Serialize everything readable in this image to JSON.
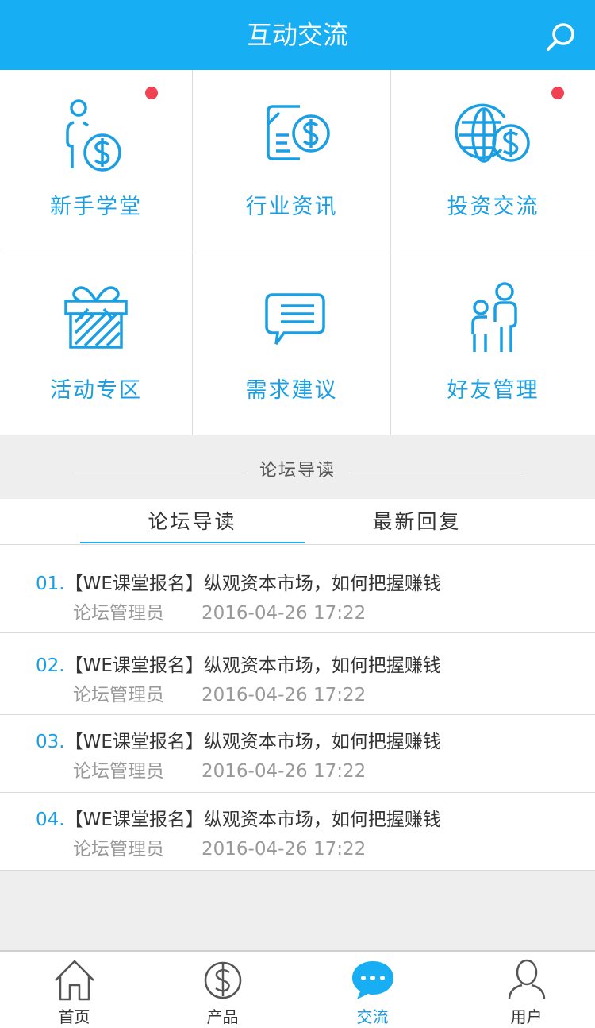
{
  "header": {
    "title": "互动交流",
    "search_icon": "search-icon"
  },
  "grid": [
    {
      "label": "新手学堂",
      "icon": "person-dollar-icon",
      "badge": true
    },
    {
      "label": "行业资讯",
      "icon": "document-dollar-icon",
      "badge": false
    },
    {
      "label": "投资交流",
      "icon": "globe-dollar-icon",
      "badge": true
    },
    {
      "label": "活动专区",
      "icon": "gift-icon",
      "badge": false
    },
    {
      "label": "需求建议",
      "icon": "message-bubble-icon",
      "badge": false
    },
    {
      "label": "好友管理",
      "icon": "friends-icon",
      "badge": false
    }
  ],
  "section": {
    "title": "论坛导读"
  },
  "tabs": [
    {
      "label": "论坛导读",
      "active": true
    },
    {
      "label": "最新回复",
      "active": false
    }
  ],
  "posts": [
    {
      "num": "01.",
      "title": "【WE课堂报名】纵观资本市场，如何把握赚钱",
      "author": "论坛管理员",
      "time": "2016-04-26  17:22"
    },
    {
      "num": "02.",
      "title": "【WE课堂报名】纵观资本市场，如何把握赚钱",
      "author": "论坛管理员",
      "time": "2016-04-26  17:22"
    },
    {
      "num": "03.",
      "title": "【WE课堂报名】纵观资本市场，如何把握赚钱",
      "author": "论坛管理员",
      "time": "2016-04-26  17:22"
    },
    {
      "num": "04.",
      "title": "【WE课堂报名】纵观资本市场，如何把握赚钱",
      "author": "论坛管理员",
      "time": "2016-04-26  17:22"
    }
  ],
  "tabbar": [
    {
      "label": "首页",
      "icon": "home-icon",
      "active": false
    },
    {
      "label": "产品",
      "icon": "dollar-icon",
      "active": false
    },
    {
      "label": "交流",
      "icon": "chat-icon",
      "active": true
    },
    {
      "label": "用户",
      "icon": "user-icon",
      "active": false
    }
  ],
  "colors": {
    "brand": "#17aef3",
    "accent_text": "#1a9fe4",
    "badge": "#f24252"
  }
}
